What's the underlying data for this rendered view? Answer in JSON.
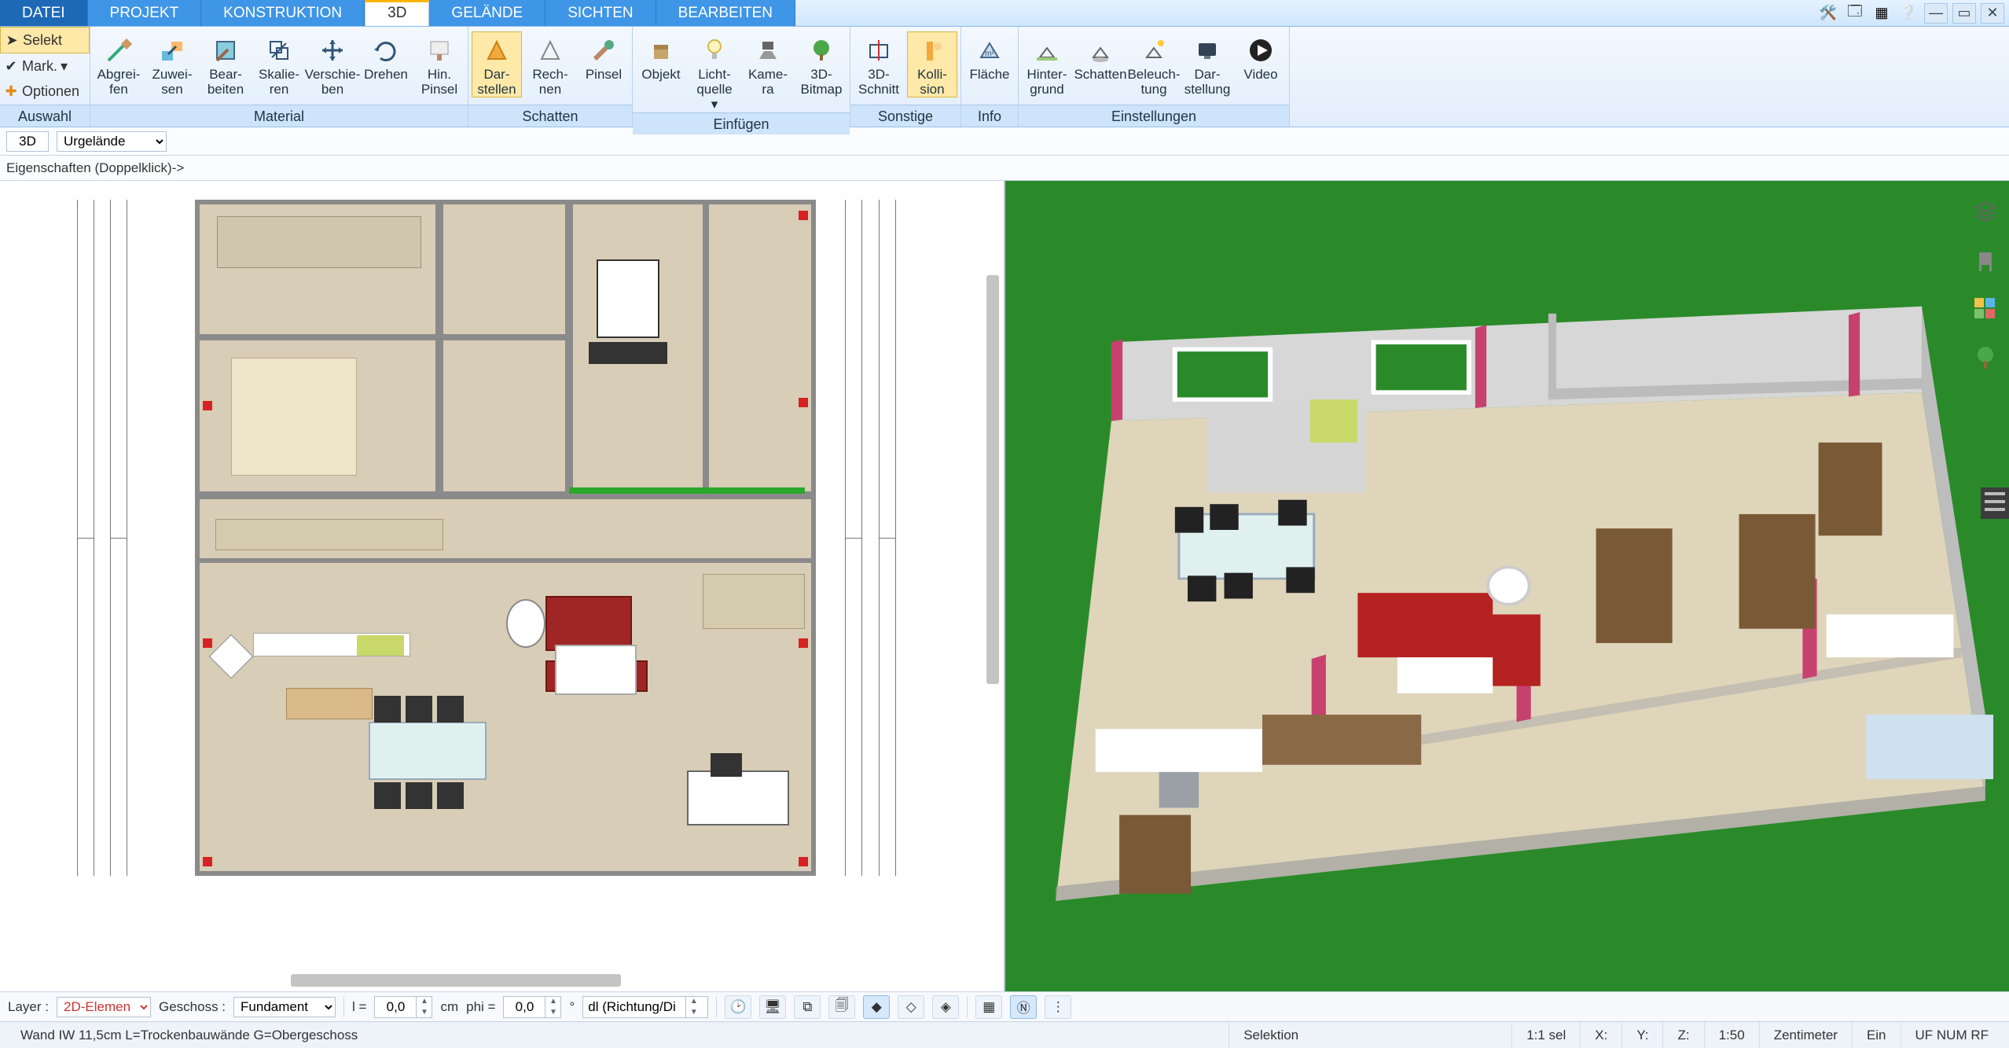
{
  "menu": {
    "tabs": [
      "DATEI",
      "PROJEKT",
      "KONSTRUKTION",
      "3D",
      "GELÄNDE",
      "SICHTEN",
      "BEARBEITEN"
    ],
    "active_index": 3
  },
  "ribbon_left": {
    "select": "Selekt",
    "mark": "Mark.",
    "options": "Optionen",
    "footer": "Auswahl"
  },
  "ribbon_groups": [
    {
      "name": "Material",
      "footer": "Material",
      "buttons": [
        {
          "id": "abgreifen",
          "label": "Abgrei-\nfen"
        },
        {
          "id": "zuweisen",
          "label": "Zuwei-\nsen"
        },
        {
          "id": "bearbeiten",
          "label": "Bear-\nbeiten"
        },
        {
          "id": "skalieren",
          "label": "Skalie-\nren"
        },
        {
          "id": "verschieben",
          "label": "Verschie-\nben"
        },
        {
          "id": "drehen",
          "label": "Drehen"
        },
        {
          "id": "hin-pinsel",
          "label": "Hin.\nPinsel"
        }
      ]
    },
    {
      "name": "Schatten",
      "footer": "Schatten",
      "buttons": [
        {
          "id": "darstellen",
          "label": "Dar-\nstellen",
          "active": true
        },
        {
          "id": "rechnen",
          "label": "Rech-\nnen"
        },
        {
          "id": "pinsel",
          "label": "Pinsel"
        }
      ]
    },
    {
      "name": "Einfuegen",
      "footer": "Einfügen",
      "buttons": [
        {
          "id": "objekt",
          "label": "Objekt"
        },
        {
          "id": "lichtquelle",
          "label": "Licht-\nquelle ▾"
        },
        {
          "id": "kamera",
          "label": "Kame-\nra"
        },
        {
          "id": "3d-bitmap",
          "label": "3D-\nBitmap"
        }
      ]
    },
    {
      "name": "Sonstige",
      "footer": "Sonstige",
      "buttons": [
        {
          "id": "3d-schnitt",
          "label": "3D-\nSchnitt"
        },
        {
          "id": "kollision",
          "label": "Kolli-\nsion",
          "active": true
        }
      ]
    },
    {
      "name": "Info",
      "footer": "Info",
      "buttons": [
        {
          "id": "flaeche",
          "label": "Fläche"
        }
      ]
    },
    {
      "name": "Einstellungen",
      "footer": "Einstellungen",
      "buttons": [
        {
          "id": "hintergrund",
          "label": "Hinter-\ngrund"
        },
        {
          "id": "schatten2",
          "label": "Schatten"
        },
        {
          "id": "beleuchtung",
          "label": "Beleuch-\ntung"
        },
        {
          "id": "darstellung",
          "label": "Dar-\nstellung"
        },
        {
          "id": "video",
          "label": "Video"
        }
      ]
    }
  ],
  "subbar": {
    "mode": "3D",
    "layer_select": "Urgelände"
  },
  "props_hint": "Eigenschaften (Doppelklick)->",
  "bottom": {
    "layer_label": "Layer :",
    "layer_value": "2D-Elemen",
    "floor_label": "Geschoss :",
    "floor_value": "Fundament",
    "l_label": "l =",
    "l_value": "0,0",
    "l_unit": "cm",
    "phi_label": "phi =",
    "phi_value": "0,0",
    "phi_unit": "°",
    "dl_value": "dl (Richtung/Di"
  },
  "status": {
    "left": "Wand IW 11,5cm L=Trockenbauwände G=Obergeschoss",
    "selection": "Selektion",
    "sel_ratio": "1:1 sel",
    "x": "X:",
    "y": "Y:",
    "z": "Z:",
    "scale": "1:50",
    "unit": "Zentimeter",
    "on": "Ein",
    "flags": "UF  NUM  RF"
  },
  "side_icons": [
    "layers-icon",
    "chair-icon",
    "palette-icon",
    "tree-icon"
  ]
}
